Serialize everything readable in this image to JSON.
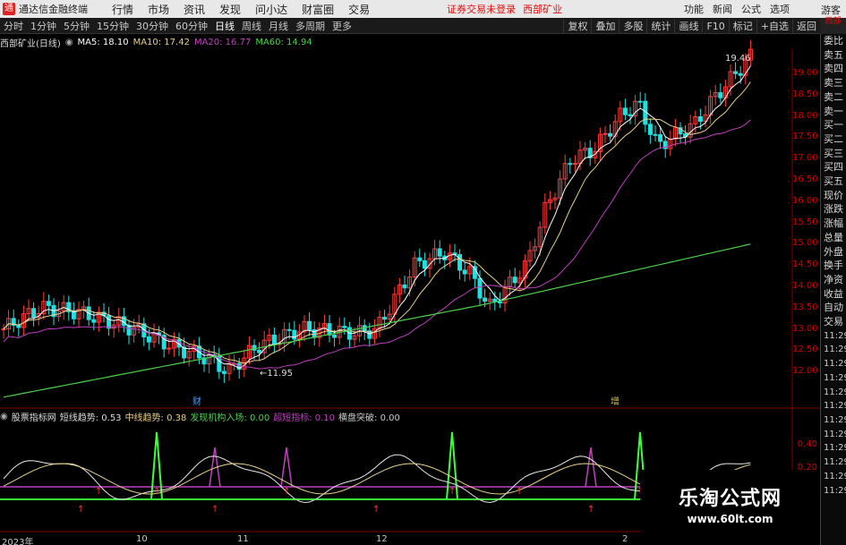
{
  "titlebar": {
    "logo": "通",
    "title": "通达信金融终端",
    "menus": [
      "行情",
      "市场",
      "资讯",
      "发现",
      "问小达",
      "财富圈",
      "交易"
    ],
    "login": "证券交易未登录",
    "stock_tag": "西部矿业",
    "right_menus": [
      "功能",
      "新闻",
      "公式",
      "选项"
    ],
    "guest": "游客"
  },
  "periods": [
    "分时",
    "1分钟",
    "5分钟",
    "15分钟",
    "30分钟",
    "60分钟",
    "日线",
    "周线",
    "月线",
    "多周期",
    "更多"
  ],
  "active_period": "日线",
  "tools": [
    "复权",
    "叠加",
    "多股",
    "统计",
    "画线",
    "F10",
    "标记",
    "+自选",
    "返回"
  ],
  "legend": {
    "stock": "西部矿业(日线)",
    "ma5": "MA5: 18.10",
    "ma10": "MA10: 17.42",
    "ma20": "MA20: 16.77",
    "ma60": "MA60: 14.94"
  },
  "colors": {
    "ma5": "#ffffff",
    "ma10": "#e8d18a",
    "ma20": "#c040c0",
    "ma60": "#4cd04c",
    "up": "#ff3c3c",
    "down": "#22e0e0",
    "axis": "#c00000"
  },
  "right_panel": {
    "top_label": "西部",
    "items": [
      "委比",
      "卖五",
      "卖四",
      "卖三",
      "卖二",
      "卖一",
      "买一",
      "买二",
      "买三",
      "买四",
      "买五",
      "现价",
      "涨跌",
      "涨幅",
      "总量",
      "外盘",
      "换手",
      "净资",
      "收益",
      "自动",
      "交易"
    ],
    "times": [
      "11:29",
      "11:29",
      "11:29",
      "11:29",
      "11:29",
      "11:29",
      "11:29",
      "11:29",
      "11:29",
      "11:29",
      "11:29",
      "11:29"
    ]
  },
  "price_axis": [
    "19.00",
    "18.50",
    "18.00",
    "17.50",
    "17.00",
    "16.50",
    "16.00",
    "15.50",
    "15.00",
    "14.50",
    "14.00",
    "13.50",
    "13.00",
    "12.50",
    "12.00"
  ],
  "annotations": {
    "high": "19.46",
    "low": "11.95",
    "event1": "财",
    "event2": "增"
  },
  "indicator": {
    "name": "股票指标网",
    "short": "短线趋势: 0.53",
    "mid": "中线趋势: 0.38",
    "inst": "发现机构入场: 0.00",
    "ultra": "超短指标: 0.10",
    "break": "横盘突破: 0.00",
    "axis": [
      "0.40",
      "0.20"
    ]
  },
  "x_axis": [
    "2023年",
    "10",
    "11",
    "12",
    "2"
  ],
  "watermark": {
    "title": "乐淘公式网",
    "url": "www.60lt.com"
  }
}
